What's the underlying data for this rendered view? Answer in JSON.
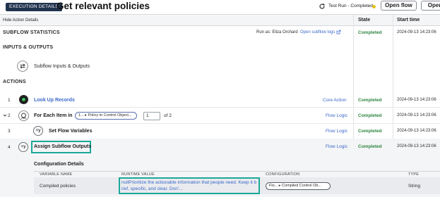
{
  "header": {
    "badge": "EXECUTION DETAILS",
    "title": "Get relevant policies",
    "test_run": "Test Run - Completed",
    "open_flow": "Open flow",
    "open": "Open"
  },
  "subheader": {
    "hide_details": "Hide Action Details",
    "col_state": "State",
    "col_start": "Start time"
  },
  "subflow_stats": {
    "title": "SUBFLOW STATISTICS",
    "run_as": "Run as: Eliza Orchard",
    "logs_link": "Open subflow logs",
    "state": "Completed",
    "time": "2024-09-13 14:23:06"
  },
  "inputs_outputs": {
    "title": "INPUTS & OUTPUTS",
    "item": "Subflow Inputs & Outputs"
  },
  "actions": {
    "title": "ACTIONS",
    "rows": [
      {
        "num": "1",
        "label": "Look Up Records",
        "type": "Core Action",
        "state": "Completed",
        "time": "2024-09-13 14:23:06"
      },
      {
        "num": "2",
        "label": "For Each Item in",
        "pill": "1... ▸ Policy to Control Object...",
        "index": "1",
        "of": "of 2",
        "type": "Flow Logic",
        "state": "Completed",
        "time": "2024-09-13 14:23:06"
      },
      {
        "num": "3",
        "label": "Set Flow Variables",
        "type": "Flow Logic",
        "state": "Completed",
        "time": "2024-09-13 14:23:06"
      },
      {
        "num": "4",
        "label": "Assign Subflow Outputs",
        "type": "Flow Logic",
        "state": "Completed",
        "time": "2024-09-13 14:23:06"
      }
    ]
  },
  "config": {
    "title": "Configuration Details",
    "headers": [
      "VARIABLE NAME",
      "RUNTIME VALUE",
      "CONFIGURATION",
      "TYPE"
    ],
    "row": {
      "name": "Compiled policies",
      "value": "nullPrioritize the actionable information that people need. Keep it b rief, specific, and clear. Don'...",
      "config_pill": "Flo... ▸ Compiled Control Ob...",
      "type": "String"
    }
  },
  "icons": {
    "row1": "lookup-records-icon",
    "row2": "for-each-icon",
    "row3": "set-variables-icon",
    "row4": "assign-outputs-icon"
  },
  "colors": {
    "badge_bg": "#20334d",
    "completed": "#2e8540",
    "link": "#3b68c9",
    "highlight": "#1ba89a"
  }
}
